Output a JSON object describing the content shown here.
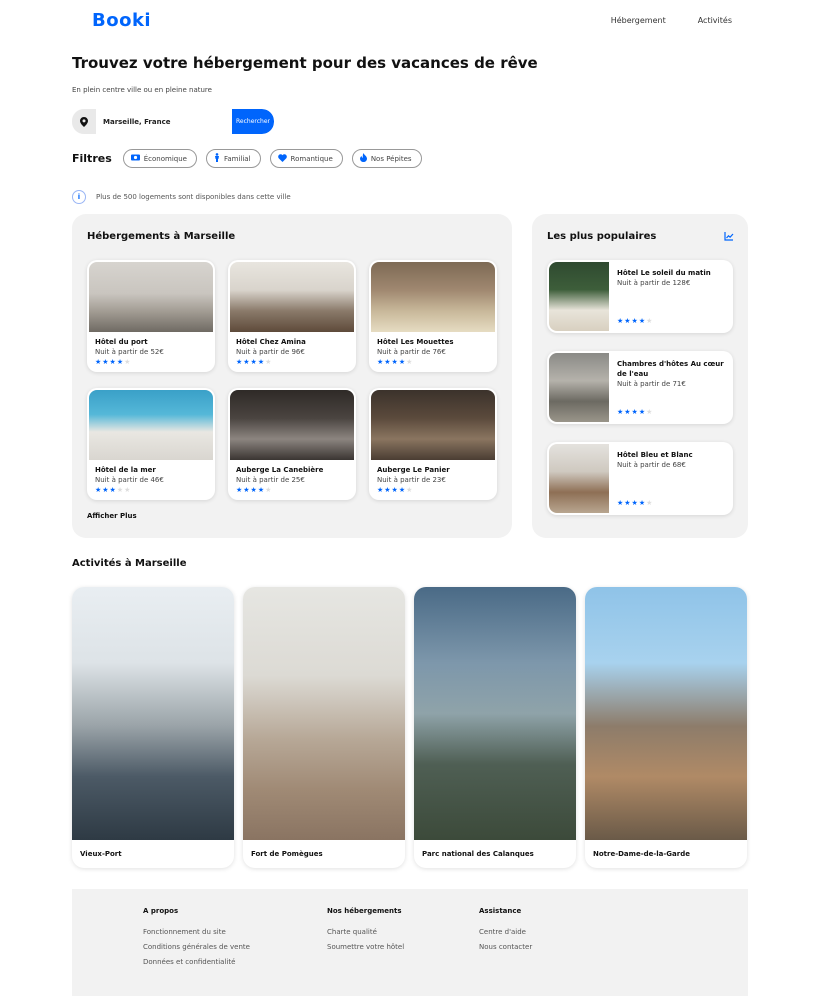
{
  "header": {
    "logo": "Booki",
    "nav": [
      "Hébergement",
      "Activités"
    ]
  },
  "hero": {
    "title": "Trouvez votre hébergement pour des vacances de rêve",
    "subtitle": "En plein centre ville ou en pleine nature"
  },
  "search": {
    "value": "Marseille, France",
    "button": "Rechercher",
    "icon": "location-pin-icon"
  },
  "filters": {
    "label": "Filtres",
    "items": [
      {
        "label": "Économique",
        "icon": "money-icon"
      },
      {
        "label": "Familial",
        "icon": "child-icon"
      },
      {
        "label": "Romantique",
        "icon": "heart-icon"
      },
      {
        "label": "Nos Pépites",
        "icon": "fire-icon"
      }
    ]
  },
  "info": {
    "text": "Plus de 500 logements sont disponibles dans cette ville",
    "icon": "info-icon"
  },
  "accommodations": {
    "title": "Hébergements à Marseille",
    "show_more": "Afficher Plus",
    "items": [
      {
        "name": "Hôtel du port",
        "price": "Nuit à partir de 52€",
        "rating": 4
      },
      {
        "name": "Hôtel Chez Amina",
        "price": "Nuit à partir de 96€",
        "rating": 4
      },
      {
        "name": "Hôtel Les Mouettes",
        "price": "Nuit à partir de 76€",
        "rating": 4
      },
      {
        "name": "Hôtel de la mer",
        "price": "Nuit à partir de 46€",
        "rating": 3
      },
      {
        "name": "Auberge La Canebière",
        "price": "Nuit à partir de 25€",
        "rating": 4
      },
      {
        "name": "Auberge Le Panier",
        "price": "Nuit à partir de 23€",
        "rating": 4
      }
    ]
  },
  "popular": {
    "title": "Les plus populaires",
    "icon": "trend-chart-icon",
    "items": [
      {
        "name": "Hôtel Le soleil du matin",
        "price": "Nuit à partir de 128€",
        "rating": 4
      },
      {
        "name": "Chambres d'hôtes Au cœur de l'eau",
        "price": "Nuit à partir de 71€",
        "rating": 4
      },
      {
        "name": "Hôtel Bleu et Blanc",
        "price": "Nuit à partir de 68€",
        "rating": 4
      }
    ]
  },
  "activities": {
    "title": "Activités à Marseille",
    "items": [
      "Vieux-Port",
      "Fort de Pomègues",
      "Parc national des Calanques",
      "Notre-Dame-de-la-Garde"
    ]
  },
  "footer": {
    "columns": [
      {
        "title": "A propos",
        "links": [
          "Fonctionnement du site",
          "Conditions générales de vente",
          "Données et confidentialité"
        ]
      },
      {
        "title": "Nos hébergements",
        "links": [
          "Charte qualité",
          "Soumettre votre hôtel"
        ]
      },
      {
        "title": "Assistance",
        "links": [
          "Centre d'aide",
          "Nous contacter"
        ]
      }
    ]
  },
  "colors": {
    "accent": "#0065FC",
    "panel": "#F2F2F2"
  }
}
